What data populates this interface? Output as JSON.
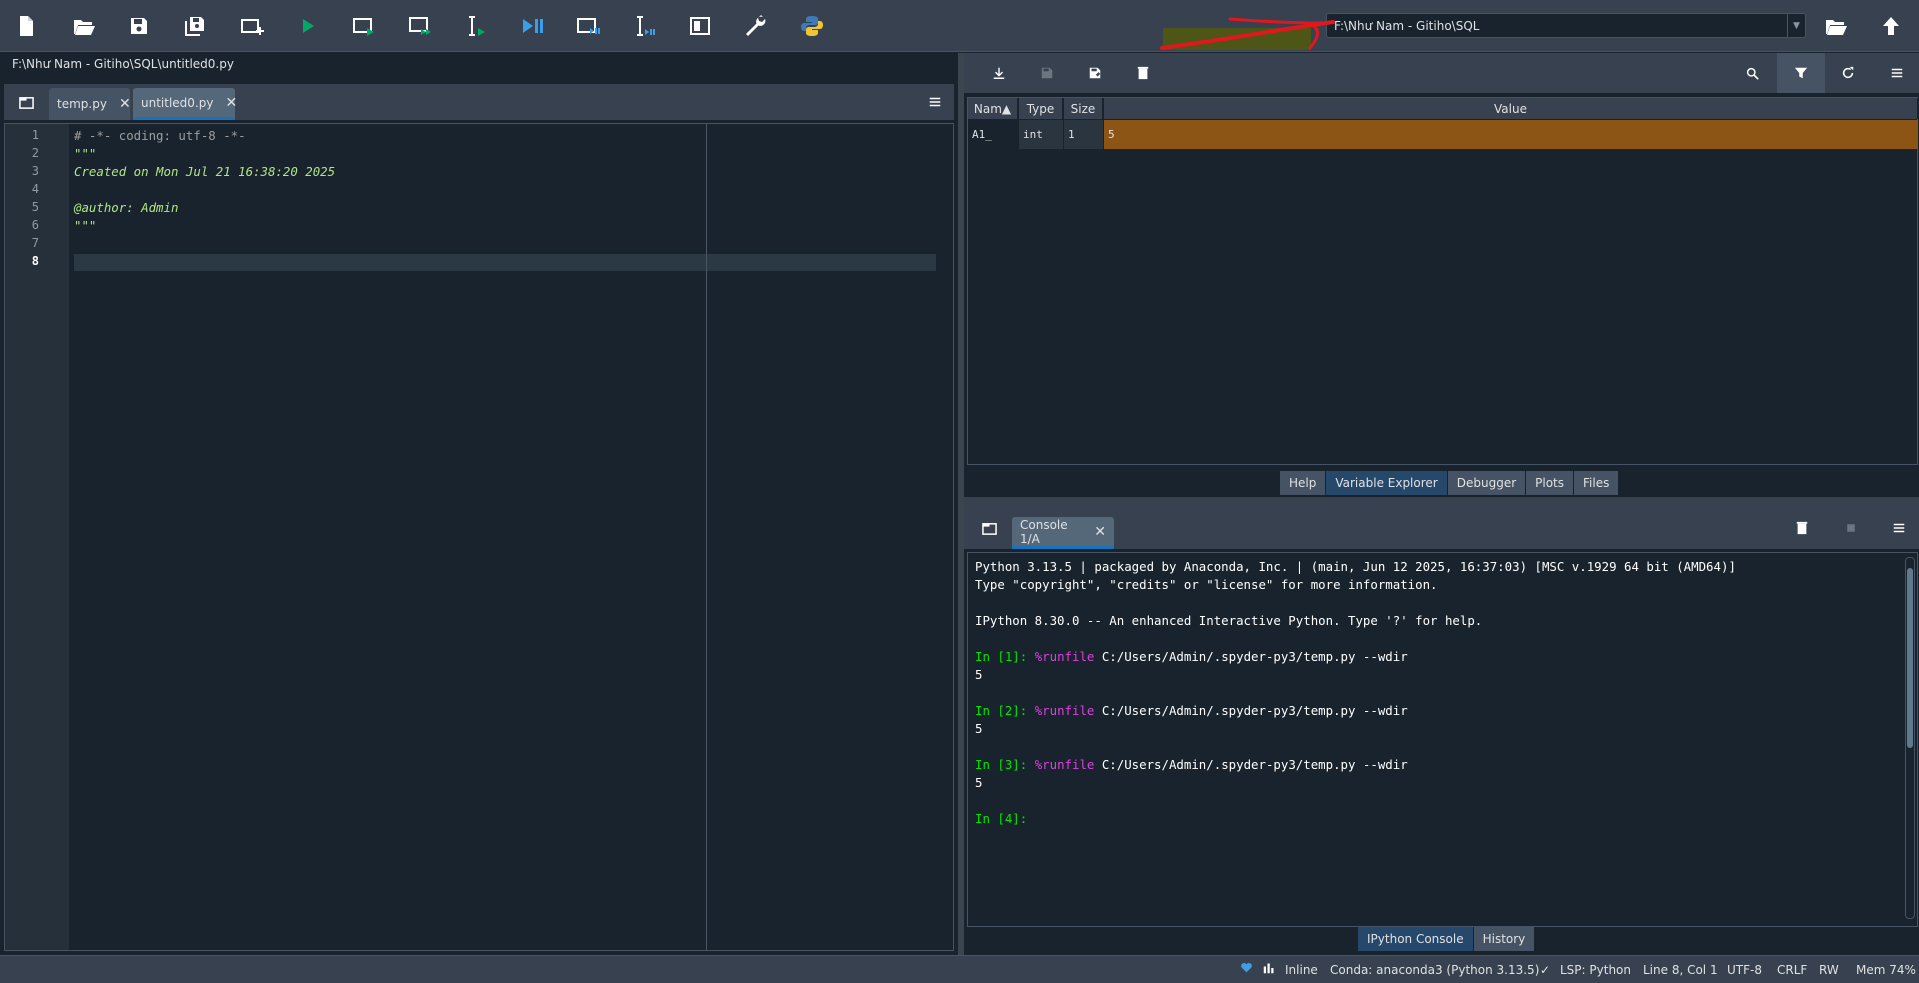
{
  "toolbar": {
    "buttons": [
      "new-file-icon",
      "open-file-icon",
      "save-file-icon",
      "save-all-icon",
      "create-cell-icon",
      "run-file-icon",
      "run-cell-icon",
      "run-cell-advance-icon",
      "run-selection-icon",
      "debug-file-icon",
      "debug-cell-icon",
      "debug-selection-icon",
      "maximize-pane-icon",
      "preferences-icon",
      "python-path-icon"
    ],
    "working_dir": "F:\\Như Nam - Gitiho\\SQL"
  },
  "editor": {
    "file_path": "F:\\Như Nam - Gitiho\\SQL\\untitled0.py",
    "tabs": [
      {
        "label": "temp.py",
        "active": false
      },
      {
        "label": "untitled0.py",
        "active": true
      }
    ],
    "line_numbers": [
      "1",
      "2",
      "3",
      "4",
      "5",
      "6",
      "7",
      "8"
    ],
    "lines": [
      "# -*- coding: utf-8 -*-",
      "\"\"\"",
      "Created on Mon Jul 21 16:38:20 2025",
      "",
      "@author: Admin",
      "\"\"\"",
      "",
      ""
    ],
    "current_line": "8"
  },
  "variable_explorer": {
    "columns": [
      "Nam▲",
      "Type",
      "Size",
      "Value"
    ],
    "rows": [
      {
        "name": "A1_",
        "type": "int",
        "size": "1",
        "value": "5"
      }
    ],
    "value_color": "#8c5516"
  },
  "top_tabs": [
    "Help",
    "Variable Explorer",
    "Debugger",
    "Plots",
    "Files"
  ],
  "console": {
    "tab_label": "Console 1/A",
    "banner1": "Python 3.13.5 | packaged by Anaconda, Inc. | (main, Jun 12 2025, 16:37:03) [MSC v.1929 64 bit (AMD64)]",
    "banner2": "Type \"copyright\", \"credits\" or \"license\" for more information.",
    "banner3": "IPython 8.30.0 -- An enhanced Interactive Python. Type '?' for help.",
    "runs": [
      {
        "prompt": "In [1]:",
        "magic": "%runfile",
        "args": " C:/Users/Admin/.spyder-py3/temp.py --wdir",
        "output": "5"
      },
      {
        "prompt": "In [2]:",
        "magic": "%runfile",
        "args": " C:/Users/Admin/.spyder-py3/temp.py --wdir",
        "output": "5"
      },
      {
        "prompt": "In [3]:",
        "magic": "%runfile",
        "args": " C:/Users/Admin/.spyder-py3/temp.py --wdir",
        "output": "5"
      }
    ],
    "next_prompt": "In [4]:"
  },
  "bottom_tabs": [
    "IPython Console",
    "History"
  ],
  "status": {
    "inline": "Inline",
    "conda": "Conda: anaconda3 (Python 3.13.5)",
    "lsp": "LSP: Python",
    "position": "Line 8, Col 1",
    "encoding": "UTF-8",
    "eol": "CRLF",
    "rw": "RW",
    "mem": "Mem 74%"
  },
  "colors": {
    "accent": "#1a72bb",
    "toolbar_bg": "#37414f",
    "annotation_red": "#e0171c"
  }
}
